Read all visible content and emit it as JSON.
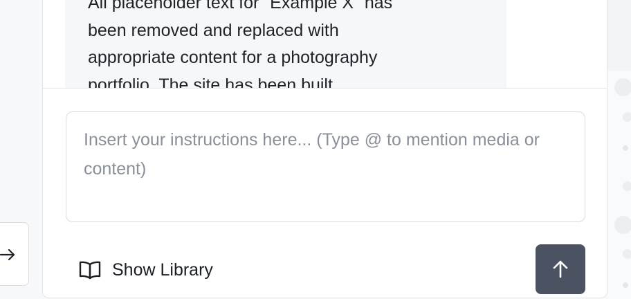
{
  "message": {
    "text_lines": [
      "All placeholder text for \"Example X\" has",
      "been removed and replaced with",
      "appropriate content for a photography",
      "portfolio. The site has been built"
    ]
  },
  "composer": {
    "placeholder": "Insert your instructions here... (Type @ to mention media or content)",
    "value": ""
  },
  "library_button": {
    "label": "Show Library",
    "icon": "book-open-icon"
  },
  "send_button": {
    "icon": "arrow-up-icon"
  },
  "side_panel_toggle": {
    "icon": "arrow-right-icon"
  },
  "colors": {
    "send_button_bg": "#4b5261",
    "page_bg": "#f7f8fa",
    "message_bubble_bg": "#f6f7f9",
    "border": "#d8dbe0"
  }
}
